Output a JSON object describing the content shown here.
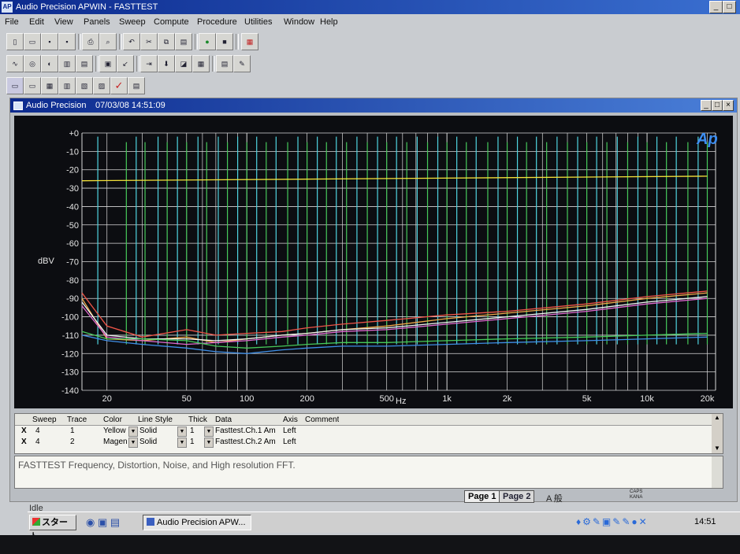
{
  "app": {
    "title": "Audio Precision APWIN - FASTTEST",
    "icon_text": "AP"
  },
  "menu": [
    "File",
    "Edit",
    "View",
    "Panels",
    "Sweep",
    "Compute",
    "Procedure",
    "Utilities",
    "Window",
    "Help"
  ],
  "child_window": {
    "title": "Audio Precision",
    "timestamp": "07/03/08 14:51:09"
  },
  "graph": {
    "logo": "Ap",
    "ylabel": "dBV",
    "xlabel": "Hz",
    "background": "#0c0d11",
    "grid_color": "#d9d9d9"
  },
  "chart_data": {
    "type": "line",
    "xscale": "log",
    "xlim": [
      15,
      22000
    ],
    "ylim": [
      -140,
      0
    ],
    "xlabel": "Hz",
    "ylabel": "dBV",
    "xticks": [
      20,
      50,
      100,
      200,
      500,
      1000,
      2000,
      5000,
      10000,
      20000
    ],
    "xtick_labels": [
      "20",
      "50",
      "100",
      "200",
      "500",
      "1k",
      "2k",
      "5k",
      "10k",
      "20k"
    ],
    "yticks": [
      0,
      -10,
      -20,
      -30,
      -40,
      -50,
      -60,
      -70,
      -80,
      -90,
      -100,
      -110,
      -120,
      -130,
      -140
    ],
    "ytick_labels": [
      "+0",
      "-10",
      "-20",
      "-30",
      "-40",
      "-50",
      "-60",
      "-70",
      "-80",
      "-90",
      "-100",
      "-110",
      "-120",
      "-130",
      "-140"
    ],
    "series": [
      {
        "color": "#f4e23a",
        "x": [
          15,
          20000
        ],
        "y": [
          -26,
          -23.5
        ]
      },
      {
        "color": "#ef5548",
        "x": [
          15,
          20,
          30,
          50,
          70,
          100,
          150,
          200,
          300,
          500,
          1000,
          2000,
          5000,
          10000,
          20000
        ],
        "y": [
          -87,
          -105,
          -111,
          -107,
          -110,
          -109,
          -108,
          -106,
          -104,
          -102,
          -99,
          -97,
          -93,
          -89,
          -86
        ]
      },
      {
        "color": "#f0a84a",
        "x": [
          15,
          20,
          30,
          50,
          70,
          100,
          150,
          200,
          300,
          500,
          1000,
          2000,
          5000,
          10000,
          20000
        ],
        "y": [
          -90,
          -112,
          -113,
          -111,
          -114,
          -112,
          -110,
          -109,
          -107,
          -105,
          -101,
          -98,
          -94,
          -90,
          -87
        ]
      },
      {
        "color": "#f3f3f3",
        "x": [
          15,
          20,
          30,
          50,
          70,
          100,
          150,
          200,
          300,
          500,
          1000,
          2000,
          5000,
          10000,
          20000
        ],
        "y": [
          -92,
          -110,
          -112,
          -112,
          -113,
          -112,
          -110,
          -109,
          -107,
          -106,
          -103,
          -100,
          -96,
          -92,
          -89
        ]
      },
      {
        "color": "#e06ad0",
        "x": [
          15,
          20,
          30,
          50,
          70,
          100,
          150,
          200,
          300,
          500,
          1000,
          2000,
          5000,
          10000,
          20000
        ],
        "y": [
          -94,
          -111,
          -113,
          -115,
          -114,
          -113,
          -111,
          -110,
          -108,
          -107,
          -104,
          -101,
          -97,
          -93,
          -90
        ]
      },
      {
        "color": "#46c95a",
        "x": [
          15,
          20,
          30,
          50,
          70,
          100,
          150,
          200,
          300,
          500,
          1000,
          2000,
          5000,
          10000,
          20000
        ],
        "y": [
          -108,
          -112,
          -112,
          -113,
          -116,
          -117,
          -116,
          -115,
          -114,
          -114,
          -113,
          -112,
          -111,
          -110,
          -109
        ]
      },
      {
        "color": "#3f8fe8",
        "x": [
          15,
          20,
          30,
          50,
          70,
          100,
          150,
          200,
          300,
          500,
          1000,
          2000,
          5000,
          10000,
          20000
        ],
        "y": [
          -110,
          -113,
          -115,
          -117,
          -119,
          -120,
          -118,
          -117,
          -116,
          -116,
          -115,
          -114,
          -113,
          -112,
          -111
        ]
      }
    ],
    "spikes": [
      {
        "color": "#46c95a",
        "x": [
          25,
          31,
          40,
          50,
          63,
          80,
          100,
          125,
          160,
          200,
          250,
          315,
          400,
          500,
          630,
          800,
          1000,
          1250,
          1600,
          2000,
          2500,
          3150,
          4000,
          5000,
          6300,
          8000,
          10000,
          12500,
          16000,
          20000
        ],
        "top": -5
      },
      {
        "color": "#4fd4e0",
        "x": [
          18,
          28,
          36,
          45,
          57,
          72,
          90,
          112,
          140,
          180,
          225,
          280,
          355,
          450,
          560,
          710,
          900,
          1120,
          1400,
          1800,
          2250,
          2800,
          3550,
          4500,
          5600,
          7100,
          9000,
          11200,
          14000,
          18000
        ],
        "top": -2
      }
    ]
  },
  "sweep_table": {
    "headers": [
      "Sweep",
      "Trace",
      "Color",
      "Line Style",
      "Thick",
      "Data",
      "Axis",
      "Comment"
    ],
    "rows": [
      {
        "mark": "X",
        "sweep": "4",
        "trace": "1",
        "color": "Yellow",
        "line_style": "Solid",
        "thick": "1",
        "data": "Fasttest.Ch.1 Am",
        "axis": "Left",
        "comment": ""
      },
      {
        "mark": "X",
        "sweep": "4",
        "trace": "2",
        "color": "Magen",
        "line_style": "Solid",
        "thick": "1",
        "data": "Fasttest.Ch.2 Am",
        "axis": "Left",
        "comment": ""
      }
    ]
  },
  "comment_text": "FASTTEST Frequency, Distortion, Noise, and High resolution FFT.",
  "status": {
    "text": "Idle",
    "page1": "Page 1",
    "page2": "Page 2"
  },
  "taskbar": {
    "start": "スタート",
    "task": "Audio Precision APW...",
    "clock": "14:51",
    "tray_ime": "A 般",
    "caps": "CAPS",
    "kana": "KANA"
  }
}
